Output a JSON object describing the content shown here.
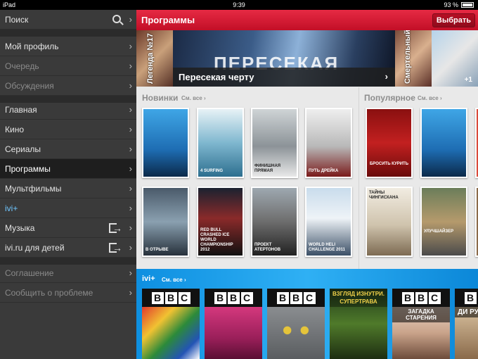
{
  "status_bar": {
    "device": "iPad",
    "time": "9:39",
    "battery": "93 %"
  },
  "sidebar": {
    "search": "Поиск",
    "items": [
      {
        "label": "Мой профиль"
      },
      {
        "label": "Очередь"
      },
      {
        "label": "Обсуждения"
      },
      {
        "label": "Главная"
      },
      {
        "label": "Кино"
      },
      {
        "label": "Сериалы"
      },
      {
        "label": "Программы"
      },
      {
        "label": "Мультфильмы"
      },
      {
        "label": "ivi+"
      },
      {
        "label": "Музыка"
      },
      {
        "label": "ivi.ru для детей"
      },
      {
        "label": "Соглашение"
      },
      {
        "label": "Сообщить о проблеме"
      }
    ]
  },
  "header": {
    "title": "Программы",
    "select_label": "Выбрать"
  },
  "banner": {
    "left_vertical": "Легенда №17",
    "big_title": "ПЕРЕСЕКАЯ",
    "caption": "Пересекая черту",
    "right_vertical": "Смертельный",
    "badge": "+1"
  },
  "sections": {
    "new": {
      "title": "Новинки",
      "see_all": "См. все"
    },
    "popular": {
      "title": "Популярное",
      "see_all": "См. все"
    }
  },
  "posters_new": [
    {
      "caption": ""
    },
    {
      "caption": "4 SURFING"
    },
    {
      "caption": "ФИНИШНАЯ ПРЯМАЯ"
    },
    {
      "caption": "ПУТЬ ДРЕЙКА"
    },
    {
      "caption": "В ОТРЫВЕ"
    },
    {
      "caption": "RED BULL CRASHED ICE WORLD CHAMPIONSHIP 2012"
    },
    {
      "caption": "ПРОЕКТ АТЕРТОНОВ"
    },
    {
      "caption": "WORLD HELI CHALLENGE 2011"
    }
  ],
  "posters_popular": [
    {
      "caption": "БРОСИТЬ КУРИТЬ"
    },
    {
      "caption": ""
    },
    {
      "caption": "ТАЙНЫ ЧИНГИСХАНА"
    },
    {
      "caption": "УЛУЧШАЙЗЕР"
    }
  ],
  "ivi_plus": {
    "title": "ivi+",
    "see_all": "См. все",
    "cards": [
      {
        "label": ""
      },
      {
        "label": ""
      },
      {
        "label": ""
      },
      {
        "label": "ВЗГЛЯД ИЗНУТРИ. СУПЕРТРАВА"
      },
      {
        "label": "ЗАГАДКА СТАРЕНИЯ"
      },
      {
        "label": "ДИ РУКО"
      }
    ]
  },
  "bbc_letters": [
    "B",
    "B",
    "C"
  ]
}
